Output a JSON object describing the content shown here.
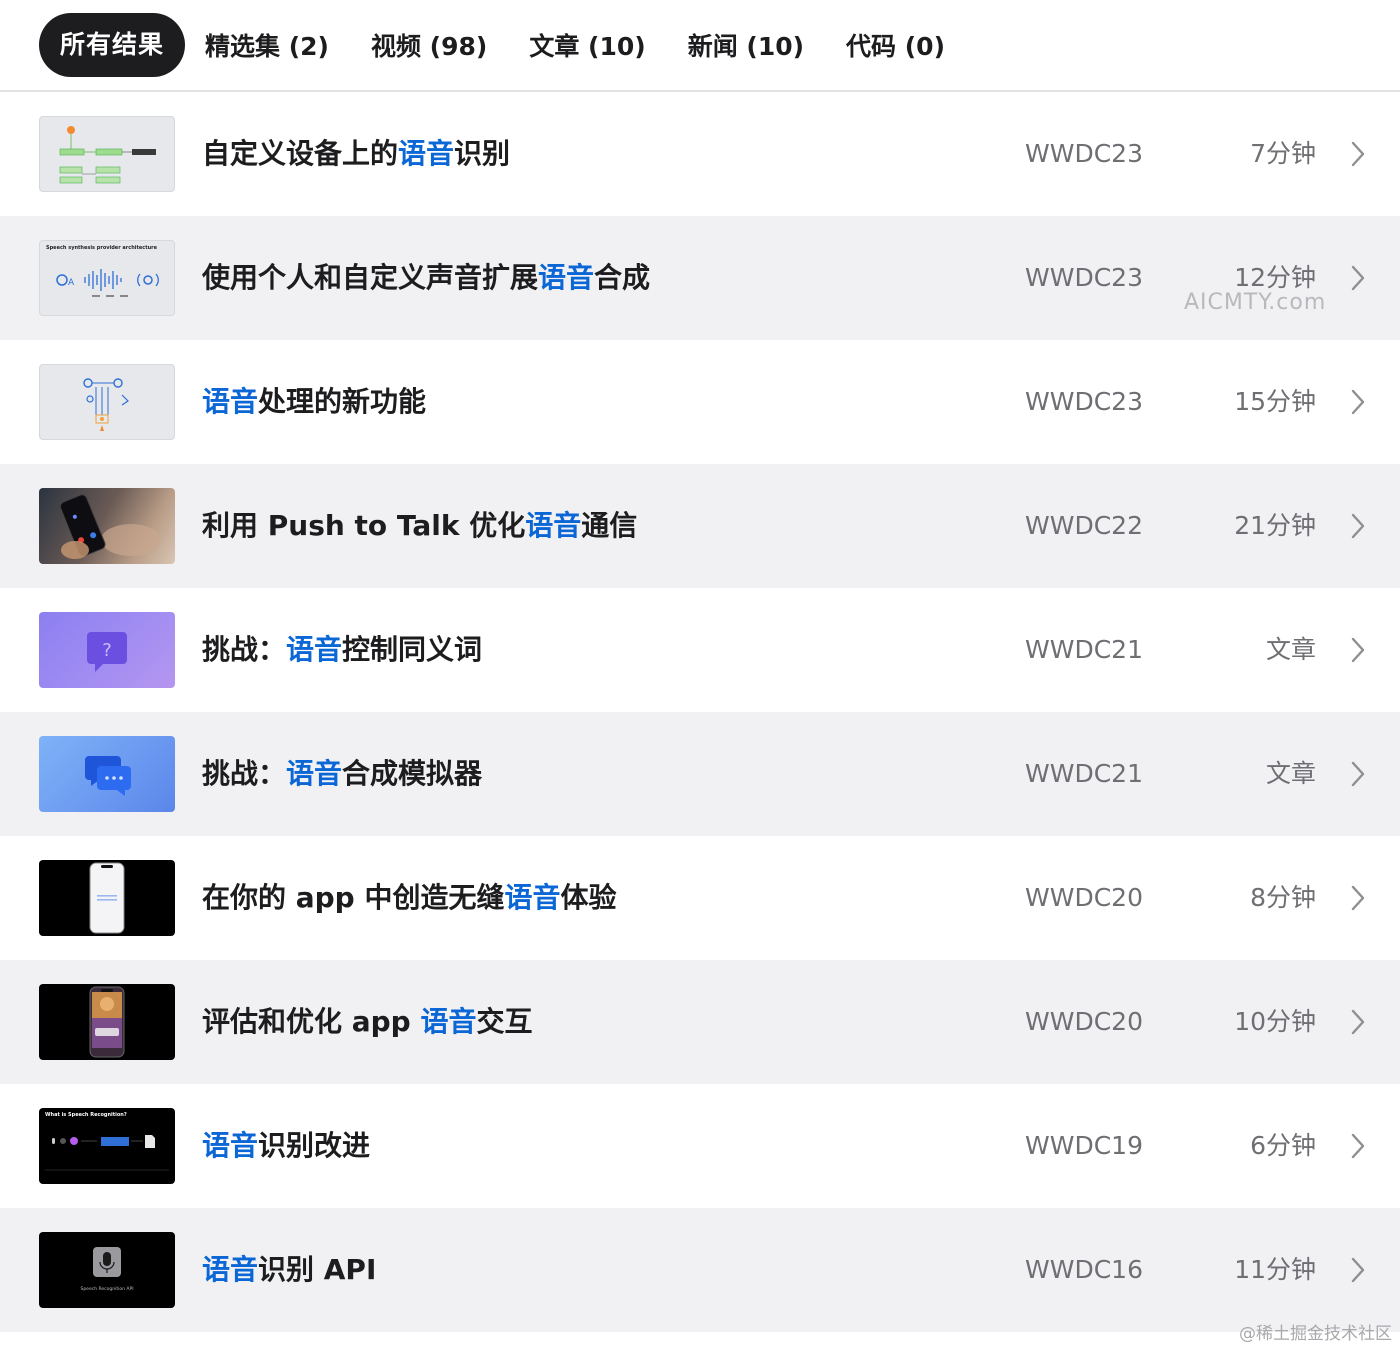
{
  "tabs": [
    {
      "label": "所有结果"
    },
    {
      "label": "精选集 (2)"
    },
    {
      "label": "视频 (98)"
    },
    {
      "label": "文章 (10)"
    },
    {
      "label": "新闻 (10)"
    },
    {
      "label": "代码 (0)"
    }
  ],
  "results": [
    {
      "pre": "自定义设备上的",
      "hl": "语音",
      "post": "识别",
      "event": "WWDC23",
      "duration": "7分钟"
    },
    {
      "pre": "使用个人和自定义声音扩展",
      "hl": "语音",
      "post": "合成",
      "event": "WWDC23",
      "duration": "12分钟"
    },
    {
      "pre": "",
      "hl": "语音",
      "post": "处理的新功能",
      "event": "WWDC23",
      "duration": "15分钟"
    },
    {
      "pre": "利用 Push to Talk 优化",
      "hl": "语音",
      "post": "通信",
      "event": "WWDC22",
      "duration": "21分钟"
    },
    {
      "pre": "挑战：",
      "hl": "语音",
      "post": "控制同义词",
      "event": "WWDC21",
      "duration": "文章"
    },
    {
      "pre": "挑战：",
      "hl": "语音",
      "post": "合成模拟器",
      "event": "WWDC21",
      "duration": "文章"
    },
    {
      "pre": "在你的 app 中创造无缝",
      "hl": "语音",
      "post": "体验",
      "event": "WWDC20",
      "duration": "8分钟"
    },
    {
      "pre": "评估和优化 app ",
      "hl": "语音",
      "post": "交互",
      "event": "WWDC20",
      "duration": "10分钟"
    },
    {
      "pre": "",
      "hl": "语音",
      "post": "识别改进",
      "event": "WWDC19",
      "duration": "6分钟"
    },
    {
      "pre": "",
      "hl": "语音",
      "post": "识别 API",
      "event": "WWDC16",
      "duration": "11分钟"
    }
  ],
  "thumbnails": {
    "t2_heading": "Speech synthesis provider architecture",
    "t9_heading": "What is Speech Recognition?",
    "t10_caption": "Speech Recognition API"
  },
  "watermarks": {
    "aicmty": "AICMTY.com",
    "juejin": "@稀土掘金技术社区"
  },
  "colors": {
    "highlight": "#0b66d6",
    "active_tab_bg": "#1d1d1f",
    "alt_row_bg": "#f1f1f4",
    "meta_text": "#6e6e73"
  }
}
